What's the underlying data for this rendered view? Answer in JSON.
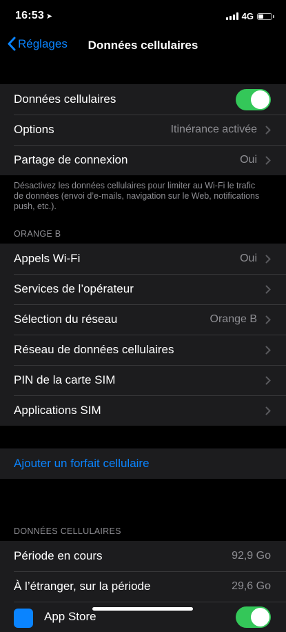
{
  "status": {
    "time": "16:53",
    "network": "4G"
  },
  "nav": {
    "back_label": "Réglages",
    "title": "Données cellulaires"
  },
  "group1": {
    "cellular_label": "Données cellulaires",
    "cellular_on": true,
    "options_label": "Options",
    "options_value": "Itinérance activée",
    "hotspot_label": "Partage de connexion",
    "hotspot_value": "Oui"
  },
  "group1_footer": "Désactivez les données cellulaires pour limiter au Wi-Fi le trafic de données (envoi d’e-mails, navigation sur le Web, notifications push, etc.).",
  "carrier_header": "ORANGE B",
  "carrier_rows": [
    {
      "label": "Appels Wi-Fi",
      "value": "Oui"
    },
    {
      "label": "Services de l’opérateur",
      "value": ""
    },
    {
      "label": "Sélection du réseau",
      "value": "Orange B"
    },
    {
      "label": "Réseau de données cellulaires",
      "value": ""
    },
    {
      "label": "PIN de la carte SIM",
      "value": ""
    },
    {
      "label": "Applications SIM",
      "value": ""
    }
  ],
  "add_plan_label": "Ajouter un forfait cellulaire",
  "usage_header": "DONNÉES CELLULAIRES",
  "usage_rows": [
    {
      "label": "Période en cours",
      "value": "92,9 Go"
    },
    {
      "label": "À l’étranger, sur la période",
      "value": "29,6 Go"
    },
    {
      "label": "App Store"
    }
  ],
  "colors": {
    "accent": "#0a84ff",
    "toggle_on": "#34c759",
    "cell_bg": "#1c1c1e",
    "secondary_text": "#8e8e93"
  }
}
